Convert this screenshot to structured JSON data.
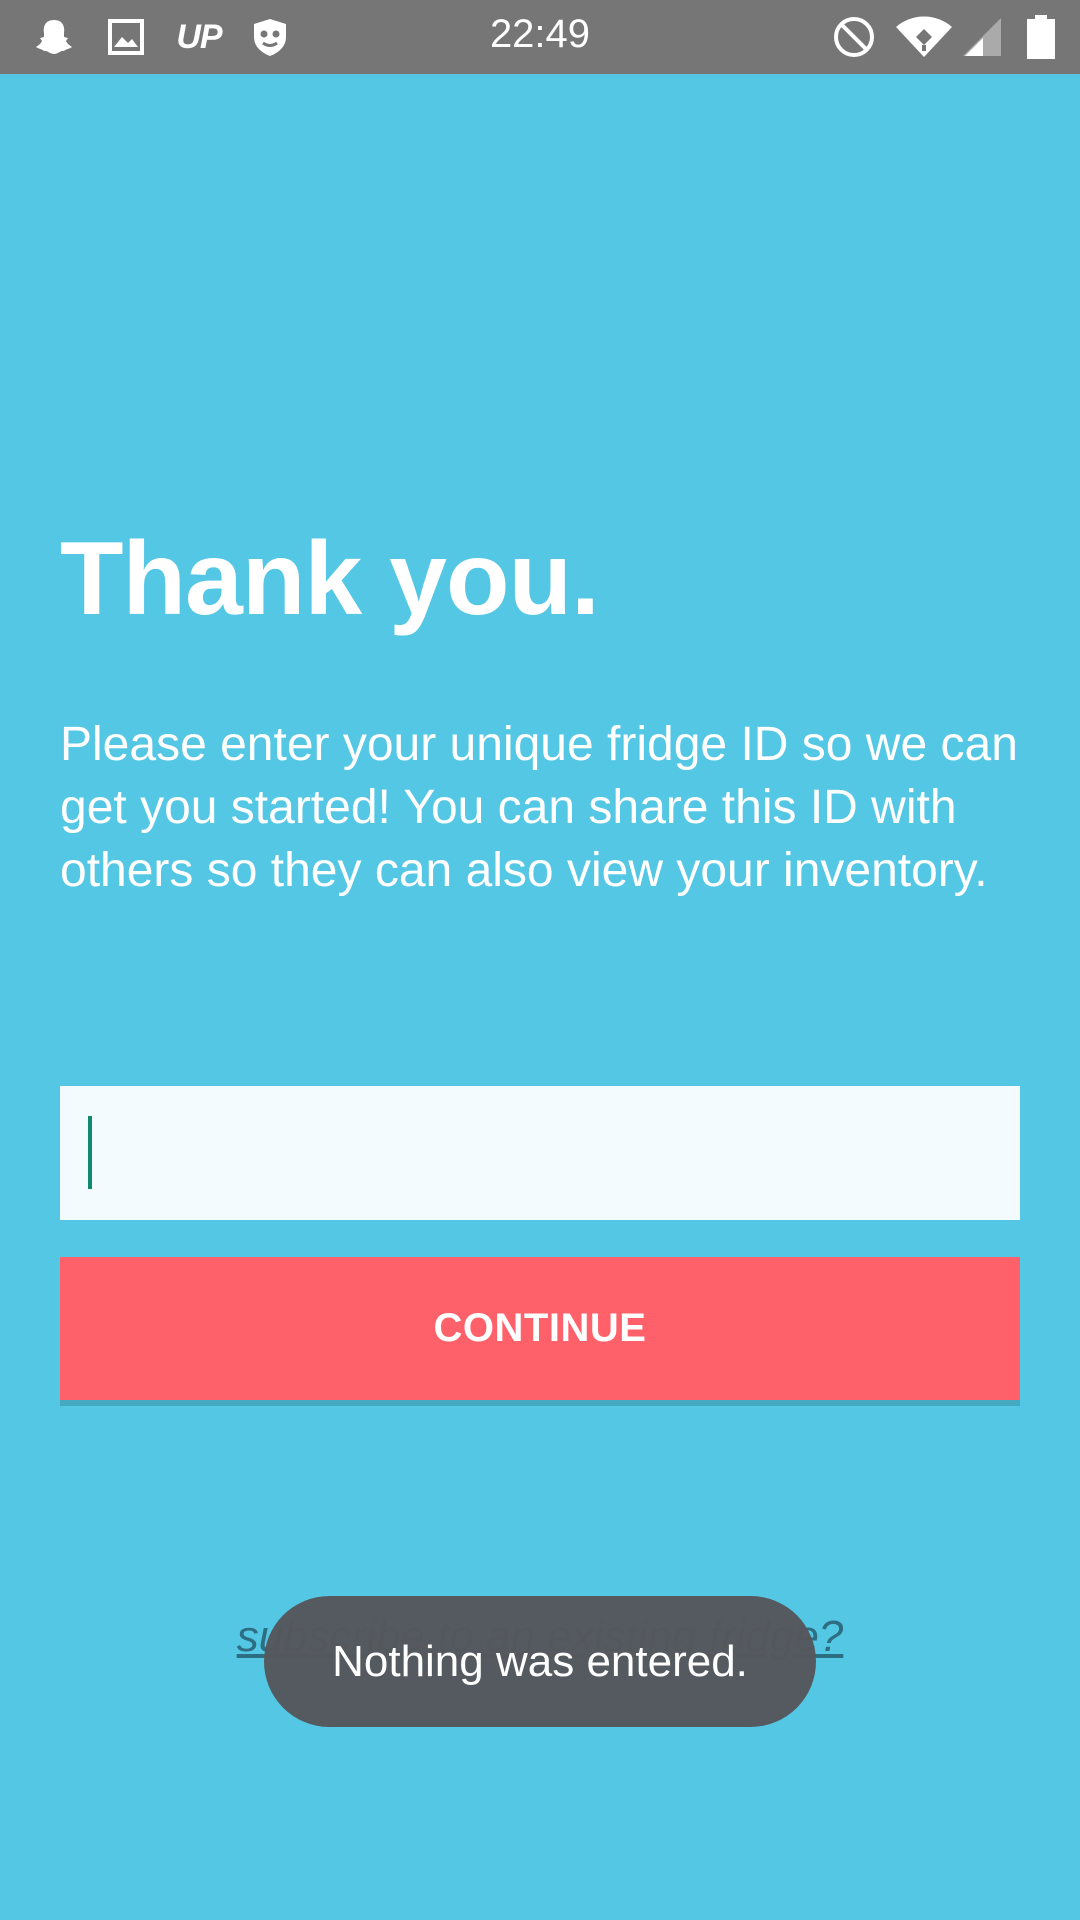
{
  "status_bar": {
    "time": "22:49",
    "left_icons": [
      "snapchat-icon",
      "image-icon",
      "up-app-icon",
      "shield-icon"
    ],
    "up_label": "UP",
    "right_icons": [
      "do-not-disturb-icon",
      "wifi-icon",
      "signal-icon",
      "battery-icon"
    ]
  },
  "main": {
    "heading": "Thank you.",
    "description": "Please enter your unique fridge ID so we can get you started! You can share this ID with others so they can also view your inventory.",
    "fridge_id_input": {
      "value": "",
      "placeholder": ""
    },
    "continue_label": "CONTINUE",
    "subscribe_link": "subscribe to an existing fridge?"
  },
  "toast": {
    "message": "Nothing was entered."
  },
  "colors": {
    "background": "#54C7E5",
    "status_bar": "#767676",
    "button": "#FF616B",
    "input_background": "#F4FBFE",
    "toast_background": "#55585C",
    "caret": "#0F8A6E"
  }
}
